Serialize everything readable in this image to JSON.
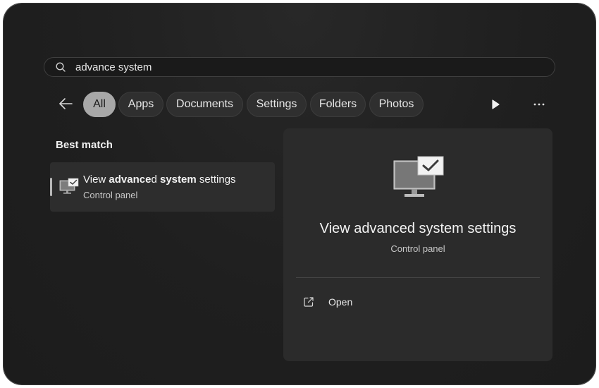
{
  "search": {
    "query": "advance system",
    "icon": "search-icon"
  },
  "filters": {
    "back_icon": "back-arrow-icon",
    "chips": [
      {
        "label": "All",
        "active": true
      },
      {
        "label": "Apps",
        "active": false
      },
      {
        "label": "Documents",
        "active": false
      },
      {
        "label": "Settings",
        "active": false
      },
      {
        "label": "Folders",
        "active": false
      },
      {
        "label": "Photos",
        "active": false
      }
    ],
    "play_icon": "play-icon",
    "more_icon": "more-options-icon"
  },
  "best_match": {
    "heading": "Best match",
    "result": {
      "title_parts": [
        "View ",
        "advance",
        "d ",
        "system",
        " settings"
      ],
      "subtitle": "Control panel",
      "icon": "monitor-check-icon"
    }
  },
  "preview": {
    "title": "View advanced system settings",
    "subtitle": "Control panel",
    "icon": "monitor-check-icon",
    "actions": [
      {
        "label": "Open",
        "icon": "open-external-icon"
      }
    ]
  },
  "colors": {
    "panel_bg": "#202020",
    "chip_active_bg": "#a8a8a8",
    "chip_bg": "#2f2f2f",
    "preview_bg": "#2b2b2b"
  }
}
